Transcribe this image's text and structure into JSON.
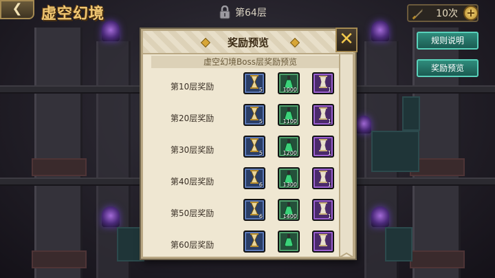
{
  "header": {
    "back_icon": "chevron-left-icon",
    "title": "虚空幻境",
    "floor_label": "第64层",
    "count_label": "10次",
    "plus_label": "+"
  },
  "side_buttons": {
    "rules": "规则说明",
    "reward_preview": "奖励预览"
  },
  "modal": {
    "title": "奖励预览",
    "close_label": "✕",
    "subtitle": "虚空幻境Boss层奖励预览",
    "rows": [
      {
        "label": "第10层奖励",
        "items": [
          {
            "icon": "hourglass-icon",
            "qty": "5",
            "rarity": "blue"
          },
          {
            "icon": "potion-icon",
            "qty": "1000",
            "rarity": "green"
          },
          {
            "icon": "scroll-icon",
            "qty": "1",
            "rarity": "purple"
          }
        ]
      },
      {
        "label": "第20层奖励",
        "items": [
          {
            "icon": "hourglass-icon",
            "qty": "5",
            "rarity": "blue"
          },
          {
            "icon": "potion-icon",
            "qty": "1100",
            "rarity": "green"
          },
          {
            "icon": "scroll-icon",
            "qty": "1",
            "rarity": "purple"
          }
        ]
      },
      {
        "label": "第30层奖励",
        "items": [
          {
            "icon": "hourglass-icon",
            "qty": "5",
            "rarity": "blue"
          },
          {
            "icon": "potion-icon",
            "qty": "1200",
            "rarity": "green"
          },
          {
            "icon": "scroll-icon",
            "qty": "1",
            "rarity": "purple"
          }
        ]
      },
      {
        "label": "第40层奖励",
        "items": [
          {
            "icon": "hourglass-icon",
            "qty": "6",
            "rarity": "blue"
          },
          {
            "icon": "potion-icon",
            "qty": "1300",
            "rarity": "green"
          },
          {
            "icon": "scroll-icon",
            "qty": "1",
            "rarity": "purple"
          }
        ]
      },
      {
        "label": "第50层奖励",
        "items": [
          {
            "icon": "hourglass-icon",
            "qty": "6",
            "rarity": "blue"
          },
          {
            "icon": "potion-icon",
            "qty": "1400",
            "rarity": "green"
          },
          {
            "icon": "scroll-icon",
            "qty": "1",
            "rarity": "purple"
          }
        ]
      },
      {
        "label": "第60层奖励",
        "items": [
          {
            "icon": "hourglass-icon",
            "qty": "",
            "rarity": "blue"
          },
          {
            "icon": "potion-icon",
            "qty": "",
            "rarity": "green"
          },
          {
            "icon": "scroll-icon",
            "qty": "",
            "rarity": "purple"
          }
        ]
      }
    ]
  },
  "colors": {
    "title_gold": "#f1c873",
    "teal_button": "#2f8c7c",
    "parchment": "#efe7d2"
  }
}
